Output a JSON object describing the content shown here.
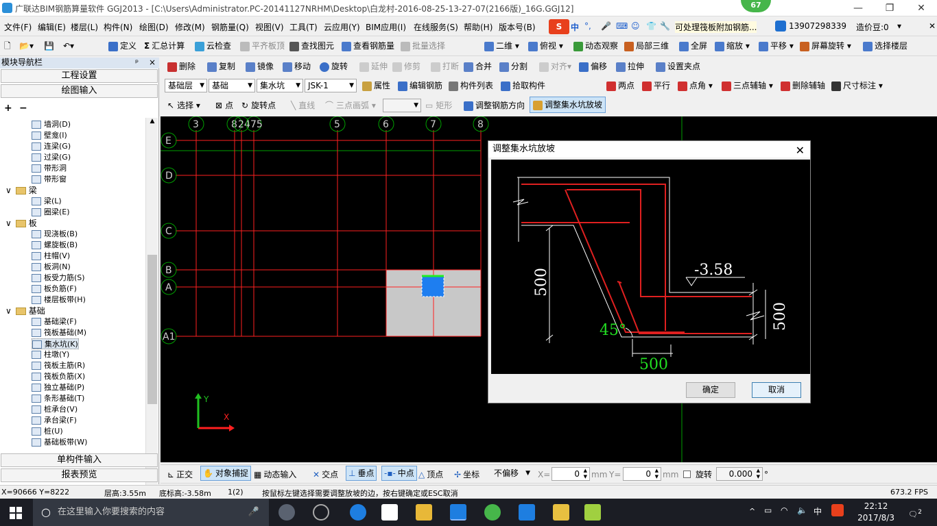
{
  "window": {
    "title": "广联达BIM钢筋算量软件 GGJ2013 - [C:\\Users\\Administrator.PC-20141127NRHM\\Desktop\\白龙村-2016-08-25-13-27-07(2166版)_16G.GGJ12]",
    "badge": "67"
  },
  "menu": [
    "文件(F)",
    "编辑(E)",
    "楼层(L)",
    "构件(N)",
    "绘图(D)",
    "修改(M)",
    "钢筋量(Q)",
    "视图(V)",
    "工具(T)",
    "云应用(Y)",
    "BIM应用(I)",
    "在线服务(S)",
    "帮助(H)",
    "版本号(B)"
  ],
  "menu_right": {
    "notice": "可处理筏板附加钢筋...",
    "phone": "13907298339",
    "coins": "造价豆:0"
  },
  "ime": {
    "label": "中"
  },
  "toolbar1": [
    "定义",
    "汇总计算",
    "云检查",
    "平齐板顶",
    "查找图元",
    "查看钢筋量",
    "批量选择",
    "二维",
    "俯视",
    "动态观察",
    "局部三维",
    "全屏",
    "缩放",
    "平移",
    "屏幕旋转",
    "选择楼层"
  ],
  "toolbar2": [
    "删除",
    "复制",
    "镜像",
    "移动",
    "旋转",
    "延伸",
    "修剪",
    "打断",
    "合并",
    "分割",
    "对齐",
    "偏移",
    "拉伸",
    "设置夹点"
  ],
  "toolbar3": {
    "floor": "基础层",
    "category": "基础",
    "type": "集水坑",
    "id": "JSK-1",
    "buttons": [
      "属性",
      "编辑钢筋",
      "构件列表",
      "拾取构件"
    ],
    "aux": [
      "两点",
      "平行",
      "点角",
      "三点辅轴",
      "删除辅轴",
      "尺寸标注"
    ]
  },
  "toolbar4": [
    "选择",
    "点",
    "旋转点",
    "直线",
    "三点画弧",
    "矩形",
    "调整钢筋方向",
    "调整集水坑放坡"
  ],
  "nav": {
    "title": "模块导航栏",
    "pin": "ᵖ",
    "close": "×",
    "buttons": [
      "工程设置",
      "绘图输入"
    ],
    "bottom_buttons": [
      "单构件输入",
      "报表预览"
    ],
    "tree": [
      {
        "type": "item",
        "label": "墙洞(D)"
      },
      {
        "type": "item",
        "label": "壁龛(I)"
      },
      {
        "type": "item",
        "label": "连梁(G)"
      },
      {
        "type": "item",
        "label": "过梁(G)"
      },
      {
        "type": "item",
        "label": "带形洞"
      },
      {
        "type": "item",
        "label": "带形窗"
      },
      {
        "type": "group",
        "label": "梁"
      },
      {
        "type": "item",
        "label": "梁(L)"
      },
      {
        "type": "item",
        "label": "圈梁(E)"
      },
      {
        "type": "group",
        "label": "板"
      },
      {
        "type": "item",
        "label": "现浇板(B)"
      },
      {
        "type": "item",
        "label": "螺旋板(B)"
      },
      {
        "type": "item",
        "label": "柱帽(V)"
      },
      {
        "type": "item",
        "label": "板洞(N)"
      },
      {
        "type": "item",
        "label": "板受力筋(S)"
      },
      {
        "type": "item",
        "label": "板负筋(F)"
      },
      {
        "type": "item",
        "label": "楼层板带(H)"
      },
      {
        "type": "group",
        "label": "基础"
      },
      {
        "type": "item",
        "label": "基础梁(F)"
      },
      {
        "type": "item",
        "label": "筏板基础(M)"
      },
      {
        "type": "item",
        "label": "集水坑(K)",
        "selected": true
      },
      {
        "type": "item",
        "label": "柱墩(Y)"
      },
      {
        "type": "item",
        "label": "筏板主筋(R)"
      },
      {
        "type": "item",
        "label": "筏板负筋(X)"
      },
      {
        "type": "item",
        "label": "独立基础(P)"
      },
      {
        "type": "item",
        "label": "条形基础(T)"
      },
      {
        "type": "item",
        "label": "桩承台(V)"
      },
      {
        "type": "item",
        "label": "承台梁(F)"
      },
      {
        "type": "item",
        "label": "桩(U)"
      },
      {
        "type": "item",
        "label": "基础板带(W)"
      }
    ]
  },
  "grid": {
    "cols": [
      "3",
      "8",
      "24",
      "75",
      "5",
      "6",
      "7",
      "8"
    ],
    "rows": [
      "E",
      "D",
      "C",
      "B",
      "A",
      "A1"
    ],
    "axis_x": "X",
    "axis_y": "Y"
  },
  "dialog": {
    "title": "调整集水坑放坡",
    "elevation": "-3.58",
    "dim_left": "500",
    "dim_right": "500",
    "dim_bottom": "500",
    "angle": "45°",
    "ok": "确定",
    "cancel": "取消"
  },
  "snapbar": {
    "items": [
      "正交",
      "对象捕捉",
      "动态输入",
      "交点",
      "垂点",
      "中点",
      "顶点",
      "坐标"
    ],
    "offset_mode": "不偏移",
    "x_label": "X=",
    "x_value": "0",
    "x_unit": "mm",
    "y_label": "Y=",
    "y_value": "0",
    "y_unit": "mm",
    "rotate_label": "旋转",
    "rotate_value": "0.000",
    "rotate_unit": "°"
  },
  "status": {
    "coords": "X=90666 Y=8222",
    "floor_height": "层高:3.55m",
    "bottom_elev": "底标高:-3.58m",
    "count": "1(2)",
    "hint": "按鼠标左键选择需要调整放坡的边，按右键确定或ESC取消",
    "fps": "673.2 FPS"
  },
  "taskbar": {
    "search_placeholder": "在这里输入你要搜索的内容",
    "time": "22:12",
    "date": "2017/8/3",
    "ime": "中",
    "notif": "2"
  },
  "colors": {
    "grid_red": "#ff2020",
    "grid_green": "#00a000",
    "dim_green": "#22dd22",
    "pit_gray": "#c8c8c8",
    "pit_blue": "#1e7ef0"
  }
}
